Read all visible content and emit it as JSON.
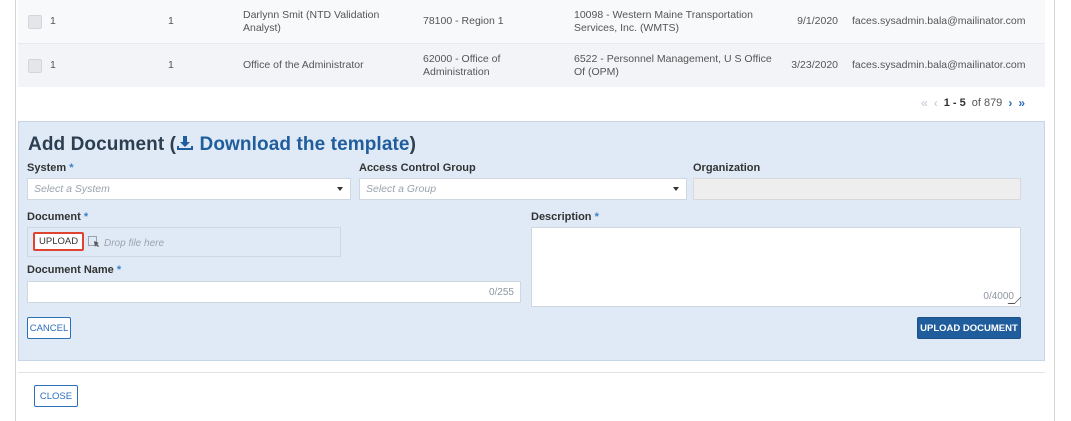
{
  "table": {
    "rows": [
      {
        "c1": "1",
        "c2": "1",
        "name": "Darlynn Smit (NTD Validation Analyst)",
        "region": "78100 - Region 1",
        "org": "10098 - Western Maine Transportation Services, Inc. (WMTS)",
        "date": "9/1/2020",
        "email": "faces.sysadmin.bala@mailinator.com"
      },
      {
        "c1": "1",
        "c2": "1",
        "name": "Office of the Administrator",
        "region": "62000 - Office of Administration",
        "org": "6522 - Personnel Management, U S Office Of (OPM)",
        "date": "3/23/2020",
        "email": "faces.sysadmin.bala@mailinator.com"
      }
    ],
    "pager": {
      "range": "1 - 5",
      "of": "of 879",
      "first_icon": "double-chevron-left-icon",
      "prev_icon": "chevron-left-icon",
      "next_icon": "chevron-right-icon",
      "last_icon": "double-chevron-right-icon"
    }
  },
  "form": {
    "title": "Add Document (",
    "download_link": "Download the template",
    "title_close": ")",
    "system_label": "System",
    "system_placeholder": "Select a System",
    "acg_label": "Access Control Group",
    "acg_placeholder": "Select a Group",
    "org_label": "Organization",
    "org_value": "",
    "document_label": "Document",
    "upload_label": "UPLOAD",
    "drop_hint": "Drop file here",
    "description_label": "Description",
    "description_counter": "0/4000",
    "docname_label": "Document Name",
    "docname_counter": "0/255",
    "required_mark": "*",
    "cancel_label": "CANCEL",
    "upload_document_label": "UPLOAD DOCUMENT"
  },
  "footer": {
    "close_label": "CLOSE"
  },
  "colors": {
    "panel_bg": "#dfeaf6",
    "primary": "#1f5d9c",
    "highlight": "#e0432f",
    "required": "#3a7fc6"
  }
}
